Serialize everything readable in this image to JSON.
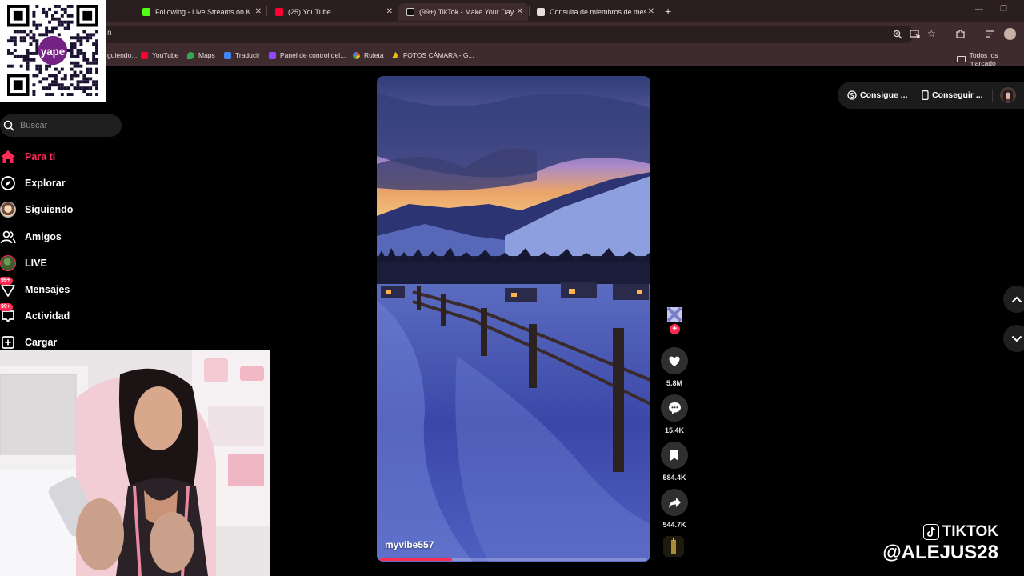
{
  "browser": {
    "tabs": [
      {
        "title": "Following - Live Streams on Kic",
        "favicon": "kick-icon",
        "color": "#53fc18"
      },
      {
        "title": "(25) YouTube",
        "favicon": "youtube-icon",
        "color": "#ff0033"
      },
      {
        "title": "(99+) TikTok - Make Your Day",
        "favicon": "tiktok-icon",
        "color": "#ffffff",
        "active": true
      },
      {
        "title": "Consulta de miembros de mesa",
        "favicon": "document-icon",
        "color": "#e8dcdc"
      }
    ],
    "address_text": "n",
    "bookmarks": [
      {
        "label": "guiendo...",
        "icon": "bookmark-icon",
        "color": "#9b6bd6"
      },
      {
        "label": "YouTube",
        "icon": "youtube-icon",
        "color": "#ff0033"
      },
      {
        "label": "Maps",
        "icon": "maps-icon",
        "color": "#34a853"
      },
      {
        "label": "Traducir",
        "icon": "translate-icon",
        "color": "#4285f4"
      },
      {
        "label": "Panel de control del...",
        "icon": "twitch-icon",
        "color": "#9146ff"
      },
      {
        "label": "Ruleta",
        "icon": "wheel-icon",
        "color": "#ea4335"
      },
      {
        "label": "FOTOS CÁMARA - G...",
        "icon": "drive-icon",
        "color": "#fbbc04"
      }
    ],
    "all_bookmarks_label": "Todos los marcado"
  },
  "qr_overlay": {
    "brand": "yape",
    "brand_color": "#742284"
  },
  "sidebar": {
    "search_placeholder": "Buscar",
    "items": [
      {
        "label": "Para ti",
        "icon": "home-icon",
        "active": true
      },
      {
        "label": "Explorar",
        "icon": "compass-icon"
      },
      {
        "label": "Siguiendo",
        "icon": "following-avatar-icon"
      },
      {
        "label": "Amigos",
        "icon": "friends-icon"
      },
      {
        "label": "LIVE",
        "icon": "live-icon"
      },
      {
        "label": "Mensajes",
        "icon": "messages-icon",
        "badge": "99+"
      },
      {
        "label": "Actividad",
        "icon": "activity-icon",
        "badge": "99+"
      },
      {
        "label": "Cargar",
        "icon": "upload-icon"
      }
    ]
  },
  "video": {
    "author": "myvibe557",
    "progress_percent": 27,
    "counts": {
      "likes": "5.8M",
      "comments": "15.4K",
      "saves": "584.4K",
      "shares": "544.7K"
    }
  },
  "top_right": {
    "coins_label": "Consigue ...",
    "app_label": "Conseguir ..."
  },
  "watermark": {
    "platform": "TIKTOK",
    "handle": "@ALEJUS28"
  },
  "colors": {
    "accent": "#fe2c55",
    "chrome_dark": "#2a1e20",
    "chrome_light": "#3d2b2e"
  }
}
